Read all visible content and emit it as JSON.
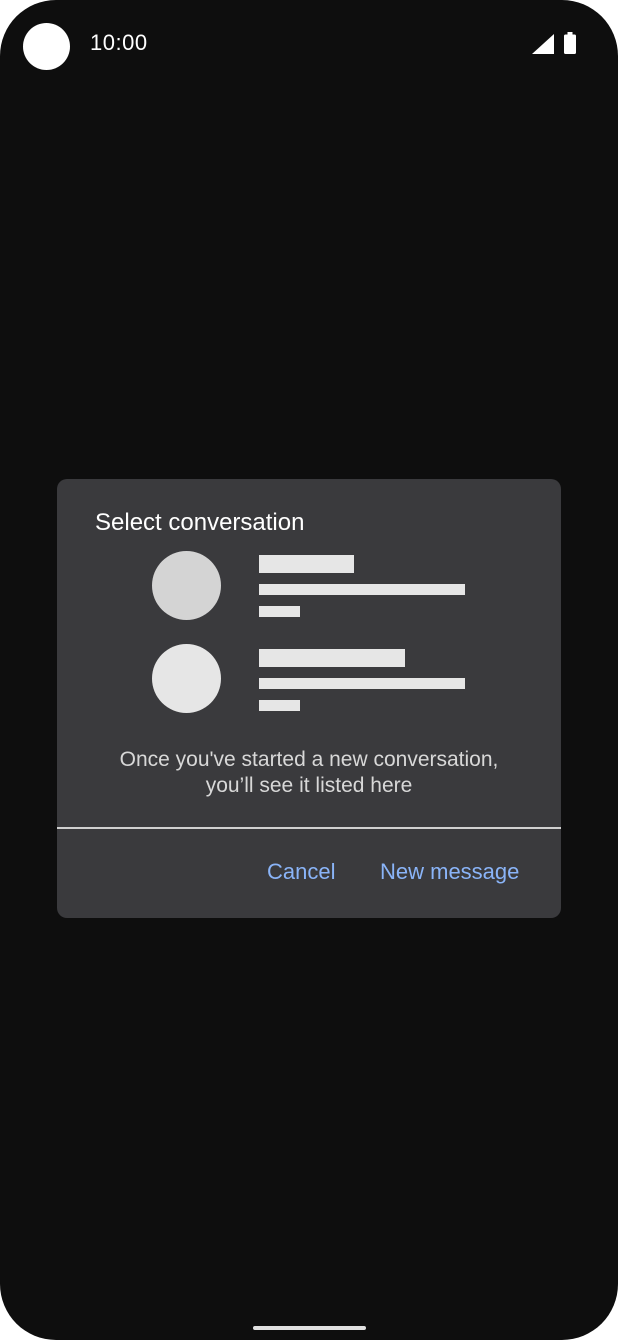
{
  "status_bar": {
    "time": "10:00",
    "icons": [
      "camera-cutout-icon",
      "signal-icon",
      "battery-icon"
    ]
  },
  "dialog": {
    "title": "Select conversation",
    "empty_message": "Once you've started a new conversation, you’ll see it listed here",
    "buttons": {
      "cancel": "Cancel",
      "new_message": "New message"
    }
  },
  "colors": {
    "background": "#0e0e0e",
    "dialog": "#3a3a3d",
    "accent": "#8ab4f8",
    "placeholder_avatar_1": "#d4d4d4",
    "placeholder_avatar_2": "#e6e6e6",
    "placeholder_bar": "#e6e6e6"
  }
}
